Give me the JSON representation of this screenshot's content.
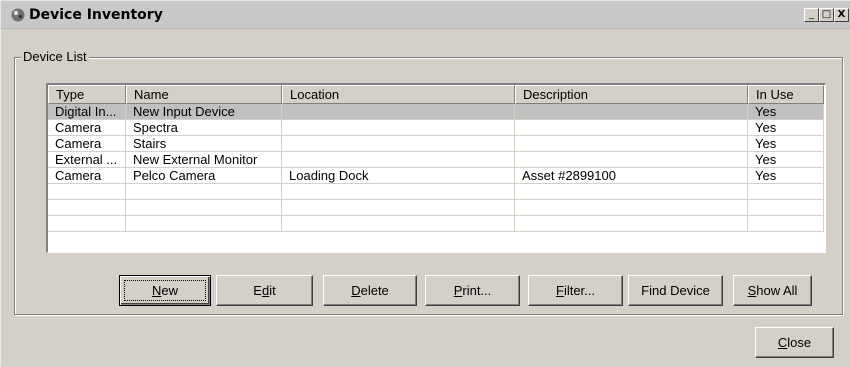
{
  "window": {
    "title": "Device Inventory",
    "minimize_label": "_",
    "maximize_label": "□",
    "close_label": "X"
  },
  "group": {
    "label": "Device List"
  },
  "table": {
    "columns": [
      "Type",
      "Name",
      "Location",
      "Description",
      "In Use"
    ],
    "rows": [
      [
        "Digital In...",
        "New Input Device",
        "",
        "",
        "Yes"
      ],
      [
        "Camera",
        "Spectra",
        "",
        "",
        "Yes"
      ],
      [
        "Camera",
        "Stairs",
        "",
        "",
        "Yes"
      ],
      [
        "External ...",
        "New External Monitor",
        "",
        "",
        "Yes"
      ],
      [
        "Camera",
        "Pelco Camera",
        "Loading Dock",
        "Asset #2899100",
        "Yes"
      ],
      [
        "",
        "",
        "",
        "",
        ""
      ],
      [
        "",
        "",
        "",
        "",
        ""
      ],
      [
        "",
        "",
        "",
        "",
        ""
      ]
    ],
    "selected_row": 0
  },
  "buttons": {
    "new": {
      "mnemonic": "N",
      "rest": "ew"
    },
    "edit": {
      "pre": "E",
      "mnemonic": "d",
      "rest": "it"
    },
    "delete": {
      "mnemonic": "D",
      "rest": "elete"
    },
    "print": {
      "mnemonic": "P",
      "rest": "rint..."
    },
    "filter": {
      "mnemonic": "F",
      "rest": "ilter..."
    },
    "find_device": "Find Device",
    "show_all": {
      "mnemonic": "S",
      "rest": "how All"
    },
    "close": {
      "mnemonic": "C",
      "rest": "lose"
    }
  },
  "colors": {
    "window_bg": "#d4d0c8",
    "titlebar_bg": "#c8c8c8",
    "selected_row_bg": "#c0c0c0"
  }
}
